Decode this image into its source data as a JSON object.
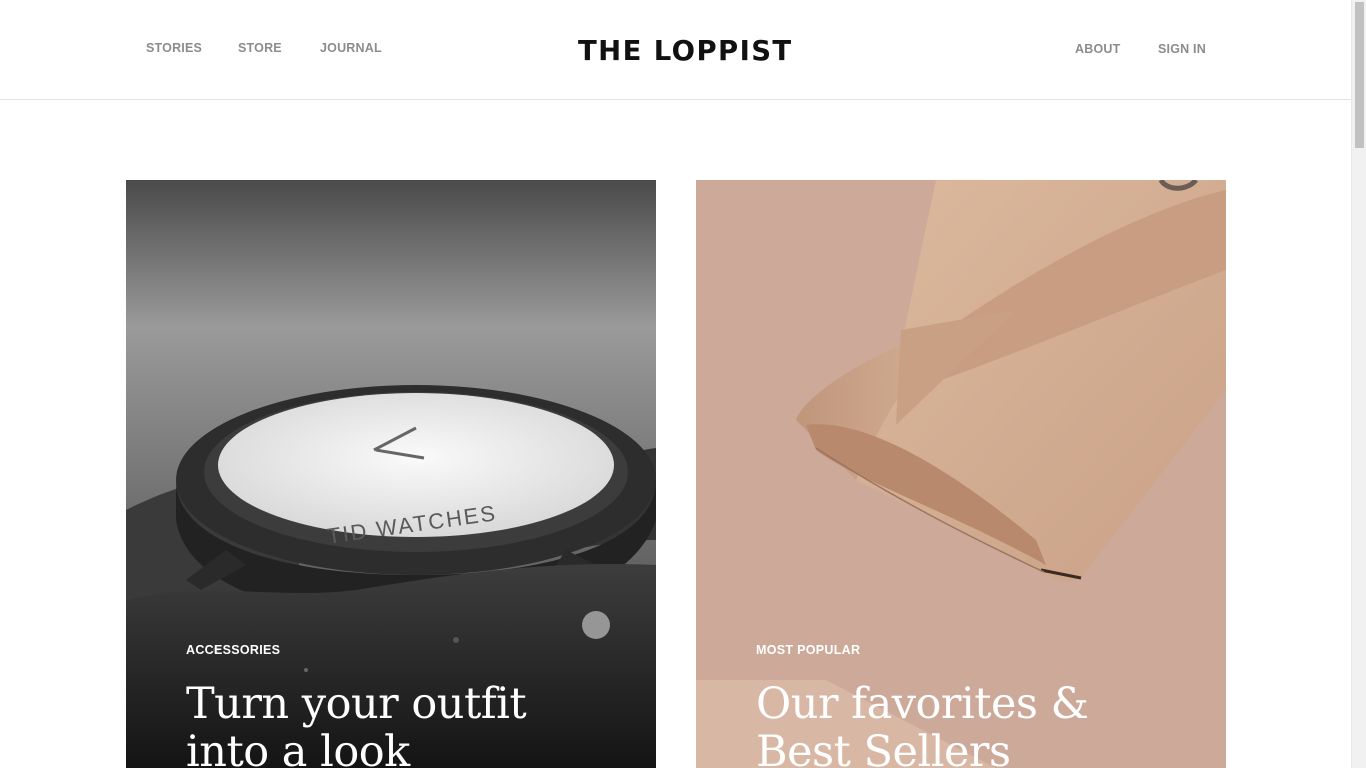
{
  "header": {
    "nav_left": [
      {
        "label": "STORIES"
      },
      {
        "label": "STORE"
      },
      {
        "label": "JOURNAL"
      }
    ],
    "logo": "THE LOPPIST",
    "nav_right": [
      {
        "label": "ABOUT"
      },
      {
        "label": "SIGN IN"
      }
    ]
  },
  "cards": [
    {
      "eyebrow": "ACCESSORIES",
      "title": "Turn your outfit\ninto a look",
      "image": {
        "icon": "watch-photo",
        "engraving": "TID WATCHES"
      }
    },
    {
      "eyebrow": "MOST POPULAR",
      "title": "Our favorites  &\nBest Sellers",
      "image": {
        "icon": "leather-wallet-photo"
      }
    }
  ],
  "colors": {
    "nav_text": "#8c8c8c",
    "logo": "#111111",
    "card_right_bg": "#cda99a"
  }
}
